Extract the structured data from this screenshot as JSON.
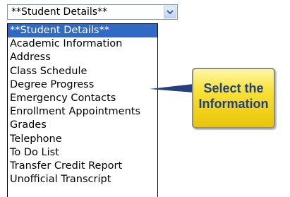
{
  "select": {
    "value": "**Student Details**"
  },
  "dropdown": {
    "options": [
      "**Student Details**",
      "Academic Information",
      "Address",
      "Class Schedule",
      "Degree Progress",
      "Emergency Contacts",
      "Enrollment Appointments",
      "Grades",
      "Telephone",
      "To Do List",
      "Transfer Credit Report",
      "Unofficial Transcript"
    ],
    "selected_index": 0
  },
  "callout": {
    "line1": "Select the",
    "line2": "Information",
    "fill_color": "#f8e23c",
    "text_color": "#1f3f86"
  },
  "colors": {
    "selection_highlight": "#316ac5"
  },
  "icons": {
    "dropdown_arrow": "chevron-down-icon"
  }
}
